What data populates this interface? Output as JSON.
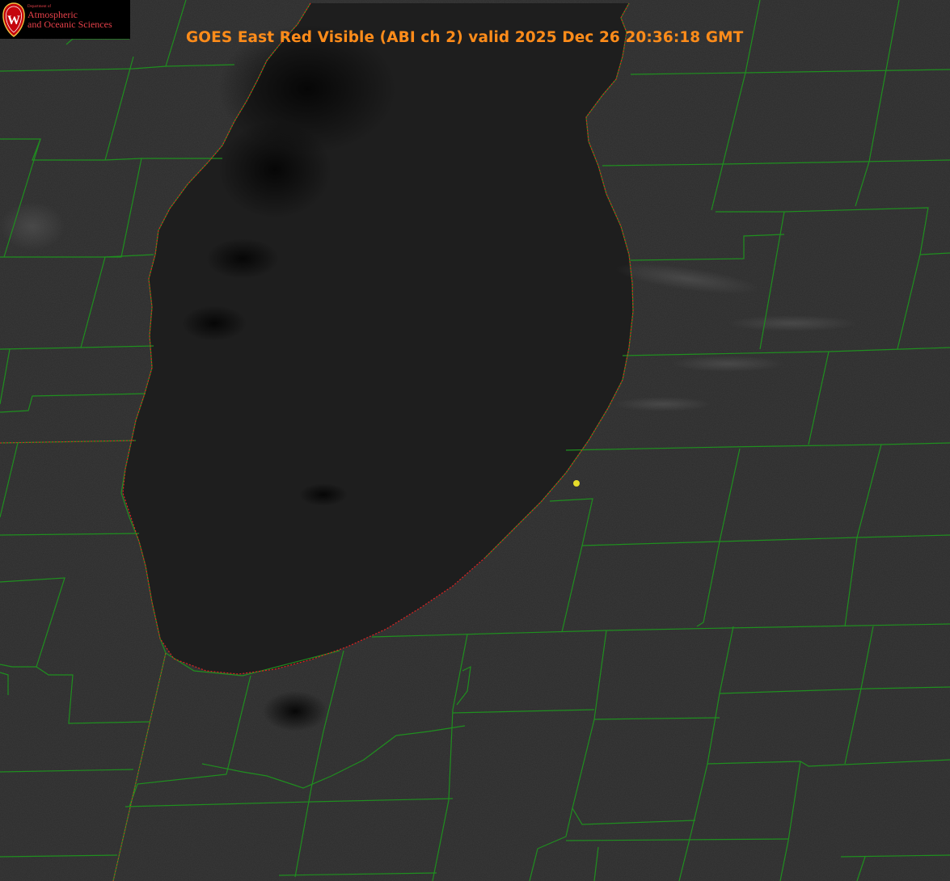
{
  "title": "GOES East Red Visible (ABI ch 2) valid 2025 Dec 26 20:36:18 GMT",
  "logo": {
    "small_text": "Department of",
    "line1": "Atmospheric",
    "line2": "and Oceanic Sciences",
    "crest_letter": "W"
  },
  "colors": {
    "land": "#2c2c2c",
    "lake": "#1d1d1d",
    "county_lines": "#1f8f1f",
    "shoreline": "#e02020",
    "title": "#ff8c1a",
    "logo_red": "#e8414a",
    "marker": "#e6dc2a"
  },
  "map": {
    "feature": "lake",
    "marker": "station-marker"
  }
}
